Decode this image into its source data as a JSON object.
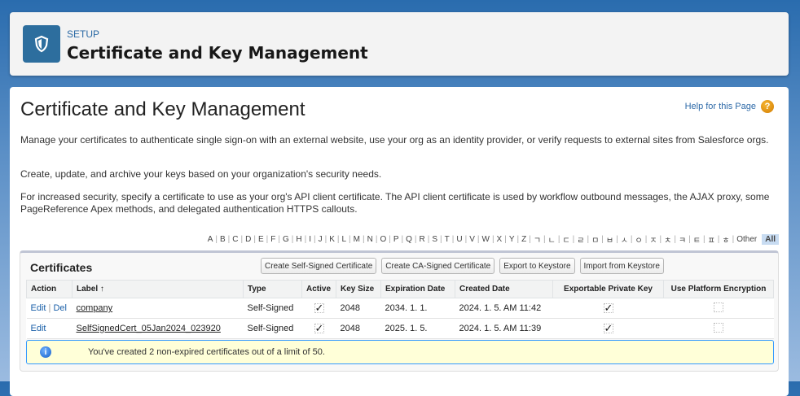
{
  "header": {
    "eyebrow": "SETUP",
    "title": "Certificate and Key Management",
    "icon": "shield-icon"
  },
  "main": {
    "title": "Certificate and Key Management",
    "help": "Help for this Page",
    "paragraphs": [
      "Manage your certificates to authenticate single sign-on with an external website, use your org as an identity provider, or verify requests to external sites from Salesforce orgs.",
      "Create, update, and archive your keys based on your organization's security needs.",
      "For increased security, specify a certificate to use as your org's API client certificate. The API client certificate is used by workflow outbound messages, the AJAX proxy, some PageReference Apex methods, and delegated authentication HTTPS callouts."
    ]
  },
  "alpha": [
    "A",
    "B",
    "C",
    "D",
    "E",
    "F",
    "G",
    "H",
    "I",
    "J",
    "K",
    "L",
    "M",
    "N",
    "O",
    "P",
    "Q",
    "R",
    "S",
    "T",
    "U",
    "V",
    "W",
    "X",
    "Y",
    "Z",
    "ㄱ",
    "ㄴ",
    "ㄷ",
    "ㄹ",
    "ㅁ",
    "ㅂ",
    "ㅅ",
    "ㅇ",
    "ㅈ",
    "ㅊ",
    "ㅋ",
    "ㅌ",
    "ㅍ",
    "ㅎ",
    "Other",
    "All"
  ],
  "certificates": {
    "title": "Certificates",
    "buttons": [
      "Create Self-Signed Certificate",
      "Create CA-Signed Certificate",
      "Export to Keystore",
      "Import from Keystore"
    ],
    "columns": [
      "Action",
      "Label ↑",
      "Type",
      "Active",
      "Key Size",
      "Expiration Date",
      "Created Date",
      "Exportable Private Key",
      "Use Platform Encryption"
    ],
    "rows": [
      {
        "edit": "Edit",
        "del": "Del",
        "label": "company",
        "type": "Self-Signed",
        "active": "✓",
        "key_size": "2048",
        "expiration": "2034. 1. 1.",
        "created": "2024. 1. 5. AM 11:42",
        "exportable": "✓",
        "platform": ""
      },
      {
        "edit": "Edit",
        "label": "SelfSignedCert_05Jan2024_023920",
        "type": "Self-Signed",
        "active": "✓",
        "key_size": "2048",
        "expiration": "2025. 1. 5.",
        "created": "2024. 1. 5. AM 11:39",
        "exportable": "✓",
        "platform": ""
      }
    ],
    "info": "You've created 2 non-expired certificates out of a limit of 50."
  }
}
